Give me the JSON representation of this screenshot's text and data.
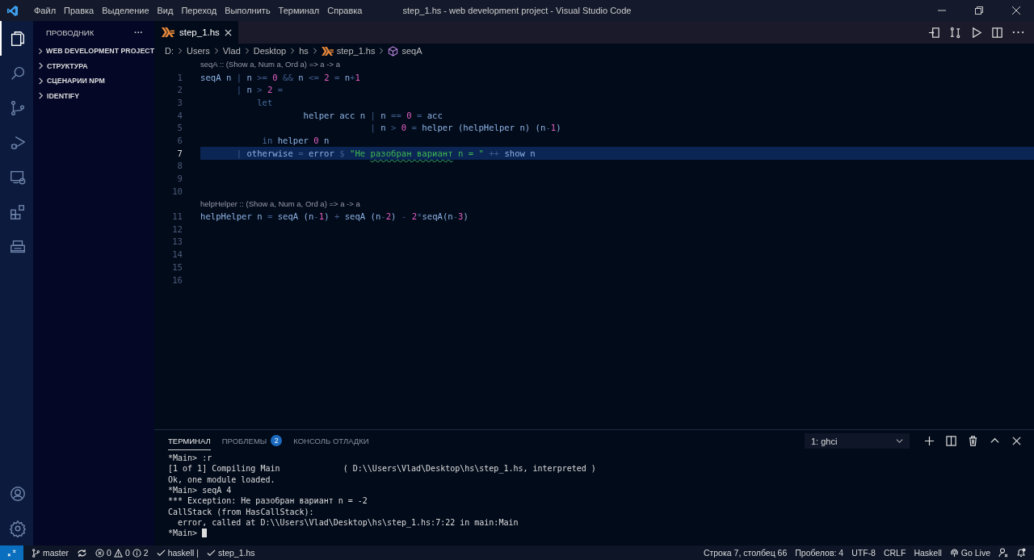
{
  "window": {
    "title": "step_1.hs - web development project - Visual Studio Code"
  },
  "menu": [
    "Файл",
    "Правка",
    "Выделение",
    "Вид",
    "Переход",
    "Выполнить",
    "Терминал",
    "Справка"
  ],
  "activity_bar": [
    {
      "selected": true
    },
    {
      "selected": false
    },
    {
      "selected": false
    },
    {
      "selected": false
    },
    {
      "selected": false
    },
    {
      "selected": false
    },
    {
      "selected": false
    }
  ],
  "sidebar": {
    "title": "ПРОВОДНИК",
    "more": "···",
    "sections": [
      {
        "label": "WEB DEVELOPMENT PROJECT",
        "expanded": false
      },
      {
        "label": "СТРУКТУРА",
        "expanded": false
      },
      {
        "label": "СЦЕНАРИИ NPM",
        "expanded": false
      },
      {
        "label": "IDENTIFY",
        "expanded": false
      }
    ]
  },
  "tabs": [
    {
      "label": "step_1.hs",
      "selected": true
    }
  ],
  "breadcrumbs": [
    {
      "label": "D:",
      "kind": "folder"
    },
    {
      "label": "Users",
      "kind": "folder"
    },
    {
      "label": "Vlad",
      "kind": "folder"
    },
    {
      "label": "Desktop",
      "kind": "folder"
    },
    {
      "label": "hs",
      "kind": "folder"
    },
    {
      "label": "step_1.hs",
      "kind": "file"
    },
    {
      "label": "seqA",
      "kind": "symbol"
    }
  ],
  "code": [
    {
      "number": "1",
      "selected": false,
      "lens": "seqA :: (Show a, Num a, Ord a) => a -> a",
      "tokens": [
        {
          "text": "seqA n ",
          "kind": "id"
        },
        {
          "text": "| ",
          "kind": "op"
        },
        {
          "text": "n ",
          "kind": "id"
        },
        {
          "text": ">= ",
          "kind": "op"
        },
        {
          "text": "0 ",
          "kind": "num"
        },
        {
          "text": "&& ",
          "kind": "op"
        },
        {
          "text": "n ",
          "kind": "id"
        },
        {
          "text": "<= ",
          "kind": "op"
        },
        {
          "text": "2 ",
          "kind": "num"
        },
        {
          "text": "= ",
          "kind": "op"
        },
        {
          "text": "n",
          "kind": "id"
        },
        {
          "text": "+",
          "kind": "op"
        },
        {
          "text": "1",
          "kind": "num"
        }
      ]
    },
    {
      "number": "2",
      "selected": false,
      "tokens": [
        {
          "text": "       | ",
          "kind": "op"
        },
        {
          "text": "n ",
          "kind": "id"
        },
        {
          "text": "> ",
          "kind": "op"
        },
        {
          "text": "2 ",
          "kind": "num"
        },
        {
          "text": "=",
          "kind": "op"
        }
      ]
    },
    {
      "number": "3",
      "selected": false,
      "tokens": [
        {
          "text": "           let",
          "kind": "kw"
        }
      ]
    },
    {
      "number": "4",
      "selected": false,
      "tokens": [
        {
          "text": "                    helper acc n ",
          "kind": "id"
        },
        {
          "text": "| ",
          "kind": "op"
        },
        {
          "text": "n ",
          "kind": "id"
        },
        {
          "text": "== ",
          "kind": "op"
        },
        {
          "text": "0 ",
          "kind": "num"
        },
        {
          "text": "= ",
          "kind": "op"
        },
        {
          "text": "acc",
          "kind": "id"
        }
      ]
    },
    {
      "number": "5",
      "selected": false,
      "tokens": [
        {
          "text": "                                 | ",
          "kind": "op"
        },
        {
          "text": "n ",
          "kind": "id"
        },
        {
          "text": "> ",
          "kind": "op"
        },
        {
          "text": "0 ",
          "kind": "num"
        },
        {
          "text": "= ",
          "kind": "op"
        },
        {
          "text": "helper (helpHelper n) (n",
          "kind": "id"
        },
        {
          "text": "-",
          "kind": "op"
        },
        {
          "text": "1",
          "kind": "num"
        },
        {
          "text": ")",
          "kind": "id"
        }
      ]
    },
    {
      "number": "6",
      "selected": false,
      "tokens": [
        {
          "text": "            in ",
          "kind": "kw"
        },
        {
          "text": "helper ",
          "kind": "id"
        },
        {
          "text": "0 ",
          "kind": "num"
        },
        {
          "text": "n",
          "kind": "id"
        }
      ]
    },
    {
      "number": "7",
      "selected": true,
      "tokens": [
        {
          "text": "       | ",
          "kind": "op"
        },
        {
          "text": "otherwise ",
          "kind": "id"
        },
        {
          "text": "= ",
          "kind": "op"
        },
        {
          "text": "error ",
          "kind": "id"
        },
        {
          "text": "$ ",
          "kind": "op"
        },
        {
          "text": "\"Не ",
          "kind": "str"
        },
        {
          "text": "разобран вариант",
          "kind": "warn"
        },
        {
          "text": " n = \" ",
          "kind": "str"
        },
        {
          "text": "++ ",
          "kind": "op"
        },
        {
          "text": "show n",
          "kind": "id"
        }
      ]
    },
    {
      "number": "8",
      "selected": false
    },
    {
      "number": "9",
      "selected": false
    },
    {
      "number": "10",
      "selected": false
    },
    {
      "number": "11",
      "selected": false,
      "lens": "helpHelper :: (Show a, Num a, Ord a) => a -> a",
      "tokens": [
        {
          "text": "helpHelper n ",
          "kind": "id"
        },
        {
          "text": "= ",
          "kind": "op"
        },
        {
          "text": "seqA (n",
          "kind": "id"
        },
        {
          "text": "-",
          "kind": "op"
        },
        {
          "text": "1",
          "kind": "num"
        },
        {
          "text": ") ",
          "kind": "id"
        },
        {
          "text": "+ ",
          "kind": "op"
        },
        {
          "text": "seqA (n",
          "kind": "id"
        },
        {
          "text": "-",
          "kind": "op"
        },
        {
          "text": "2",
          "kind": "num"
        },
        {
          "text": ") ",
          "kind": "id"
        },
        {
          "text": "- ",
          "kind": "op"
        },
        {
          "text": "2",
          "kind": "num"
        },
        {
          "text": "*",
          "kind": "op"
        },
        {
          "text": "seqA(n",
          "kind": "id"
        },
        {
          "text": "-",
          "kind": "op"
        },
        {
          "text": "3",
          "kind": "num"
        },
        {
          "text": ")",
          "kind": "id"
        }
      ]
    },
    {
      "number": "12",
      "selected": false
    },
    {
      "number": "13",
      "selected": false
    },
    {
      "number": "14",
      "selected": false
    },
    {
      "number": "15",
      "selected": false
    },
    {
      "number": "16",
      "selected": false
    }
  ],
  "panel": {
    "tabs": [
      {
        "label": "ТЕРМИНАЛ",
        "selected": true
      },
      {
        "label": "ПРОБЛЕМЫ",
        "selected": false,
        "badge": "2"
      },
      {
        "label": "КОНСОЛЬ ОТЛАДКИ",
        "selected": false
      }
    ],
    "terminal_select": "1: ghci",
    "terminal": [
      "*Main> :r",
      "[1 of 1] Compiling Main             ( D:\\\\Users\\Vlad\\Desktop\\hs\\step_1.hs, interpreted )",
      "Ok, one module loaded.",
      "*Main> seqA 4",
      "*** Exception: Не разобран вариант n = -2",
      "CallStack (from HasCallStack):",
      "  error, called at D:\\\\Users\\Vlad\\Desktop\\hs\\step_1.hs:7:22 in main:Main",
      "*Main> "
    ]
  },
  "status_bar": {
    "branch": "master",
    "errors": "0",
    "warnings": "0",
    "infos": "2",
    "checks": [
      "haskell |",
      "step_1.hs"
    ],
    "right": [
      "Строка 7, столбец 66",
      "Пробелов: 4",
      "UTF-8",
      "CRLF",
      "Haskell"
    ],
    "go_live": "Go Live"
  }
}
